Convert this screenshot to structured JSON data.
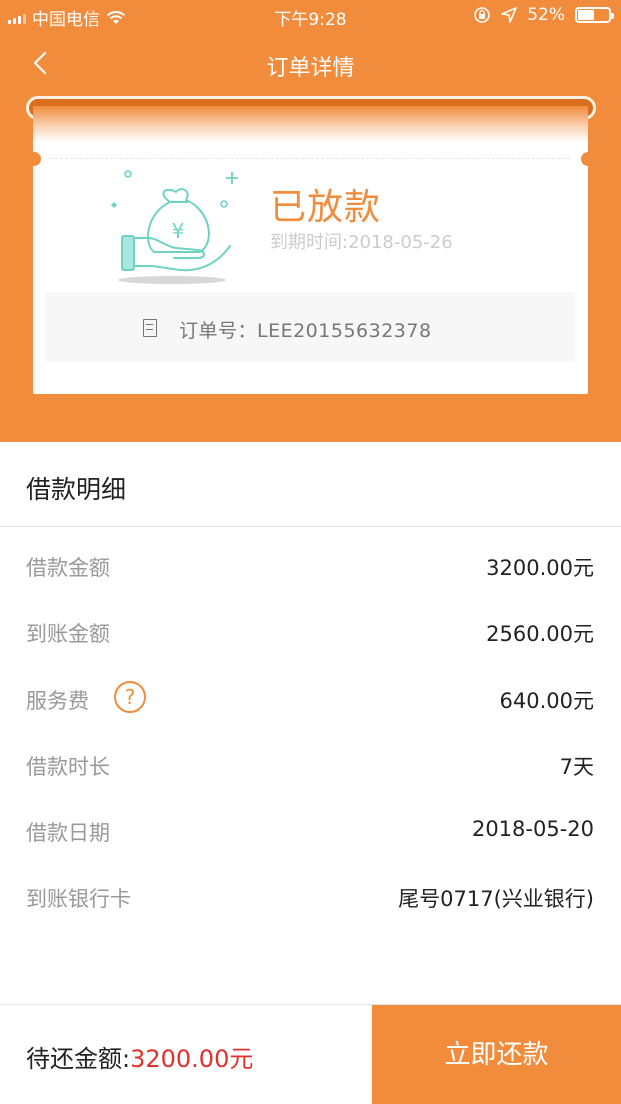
{
  "status_bar": {
    "carrier": "中国电信",
    "time": "下午9:28",
    "battery": "52%"
  },
  "nav": {
    "title": "订单详情"
  },
  "ticket": {
    "status": "已放款",
    "due_date": "到期时间:2018-05-26",
    "order_number": "订单号：LEE20155632378"
  },
  "details": {
    "title": "借款明细",
    "rows": [
      {
        "label": "借款金额",
        "value": "3200.00元"
      },
      {
        "label": "到账金额",
        "value": "2560.00元"
      },
      {
        "label": "服务费",
        "value": "640.00元",
        "help": "?"
      },
      {
        "label": "借款时长",
        "value": "7天"
      },
      {
        "label": "借款日期",
        "value": "2018-05-20"
      },
      {
        "label": "到账银行卡",
        "value": "尾号0717(兴业银行)"
      }
    ]
  },
  "footer": {
    "due_label": "待还金额:",
    "due_amount": "3200.00元",
    "pay_button": "立即还款"
  },
  "colors": {
    "accent": "#f08c3b",
    "amount_red": "#e0322d",
    "illustration_teal": "#6fd3c4"
  },
  "icons": [
    "wifi-icon",
    "lock-rotation-icon",
    "location-icon",
    "battery-icon",
    "back-arrow-icon",
    "money-bag-icon",
    "document-icon",
    "help-icon"
  ]
}
